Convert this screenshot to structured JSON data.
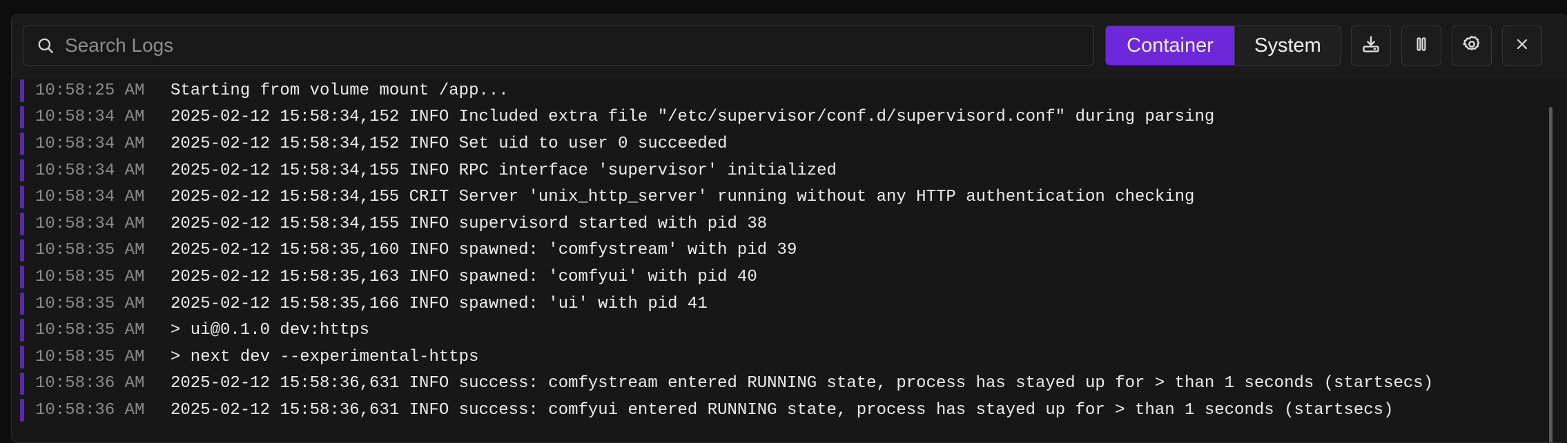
{
  "search": {
    "placeholder": "Search Logs",
    "value": ""
  },
  "source_toggle": {
    "container_label": "Container",
    "system_label": "System",
    "selected": "Container"
  },
  "toolbar_icons": {
    "download": "download-icon",
    "pause": "pause-icon",
    "settings": "gear-icon",
    "close": "close-icon"
  },
  "colors": {
    "accent": "#6d28d9",
    "log_bar": "#5b2aa8",
    "background": "#171717"
  },
  "logs": [
    {
      "time": "10:58:25 AM",
      "message": "Starting from volume mount /app..."
    },
    {
      "time": "10:58:34 AM",
      "message": "2025-02-12 15:58:34,152 INFO Included extra file \"/etc/supervisor/conf.d/supervisord.conf\" during parsing"
    },
    {
      "time": "10:58:34 AM",
      "message": "2025-02-12 15:58:34,152 INFO Set uid to user 0 succeeded"
    },
    {
      "time": "10:58:34 AM",
      "message": "2025-02-12 15:58:34,155 INFO RPC interface 'supervisor' initialized"
    },
    {
      "time": "10:58:34 AM",
      "message": "2025-02-12 15:58:34,155 CRIT Server 'unix_http_server' running without any HTTP authentication checking"
    },
    {
      "time": "10:58:34 AM",
      "message": "2025-02-12 15:58:34,155 INFO supervisord started with pid 38"
    },
    {
      "time": "10:58:35 AM",
      "message": "2025-02-12 15:58:35,160 INFO spawned: 'comfystream' with pid 39"
    },
    {
      "time": "10:58:35 AM",
      "message": "2025-02-12 15:58:35,163 INFO spawned: 'comfyui' with pid 40"
    },
    {
      "time": "10:58:35 AM",
      "message": "2025-02-12 15:58:35,166 INFO spawned: 'ui' with pid 41"
    },
    {
      "time": "10:58:35 AM",
      "message": "> ui@0.1.0 dev:https"
    },
    {
      "time": "10:58:35 AM",
      "message": "> next dev --experimental-https"
    },
    {
      "time": "10:58:36 AM",
      "message": "2025-02-12 15:58:36,631 INFO success: comfystream entered RUNNING state, process has stayed up for > than 1 seconds (startsecs)"
    },
    {
      "time": "10:58:36 AM",
      "message": "2025-02-12 15:58:36,631 INFO success: comfyui entered RUNNING state, process has stayed up for > than 1 seconds (startsecs)"
    }
  ]
}
